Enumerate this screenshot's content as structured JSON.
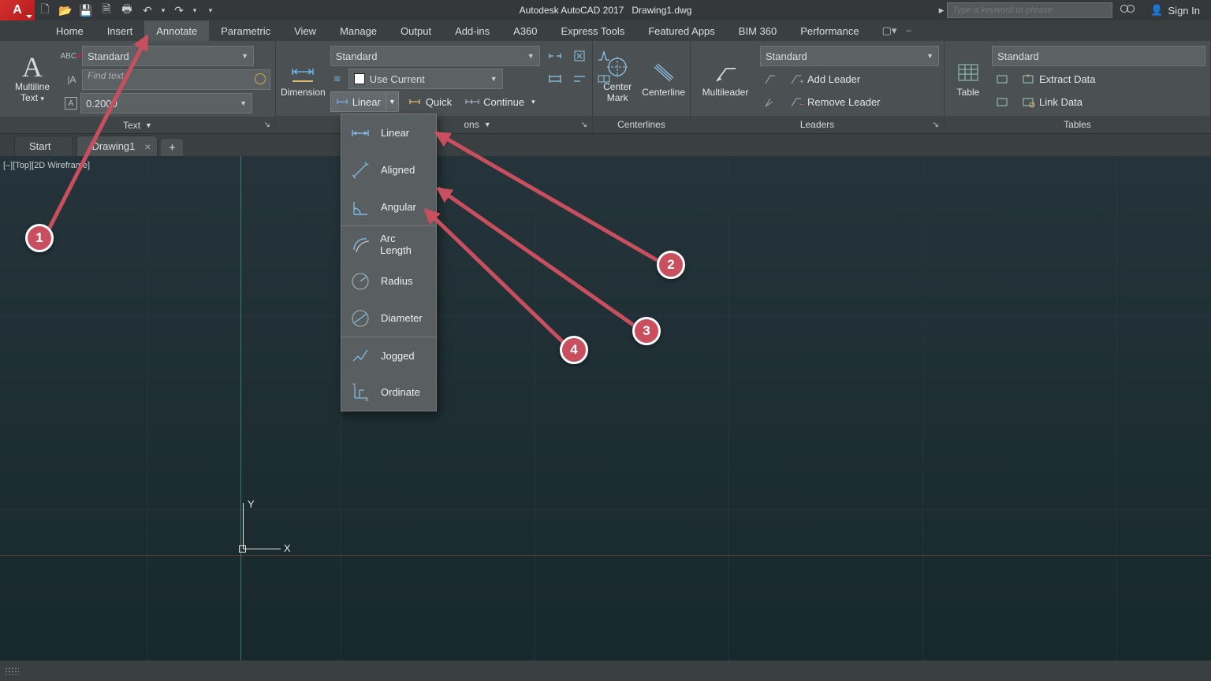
{
  "title": {
    "app": "Autodesk AutoCAD 2017",
    "doc": "Drawing1.dwg"
  },
  "search_placeholder": "Type a keyword or phrase",
  "signin": "Sign In",
  "menubar": [
    "Home",
    "Insert",
    "Annotate",
    "Parametric",
    "View",
    "Manage",
    "Output",
    "Add-ins",
    "A360",
    "Express Tools",
    "Featured Apps",
    "BIM 360",
    "Performance"
  ],
  "active_tab": "Annotate",
  "panels": {
    "text": {
      "label": "Text",
      "big": "Multiline\nText",
      "style": "Standard",
      "find_placeholder": "Find text",
      "height": "0.2000"
    },
    "dimensions": {
      "label": "Dimensions",
      "big": "Dimension",
      "style": "Standard",
      "layer": "Use Current",
      "linear": "Linear",
      "quick": "Quick",
      "continue": "Continue"
    },
    "centerlines": {
      "label": "Centerlines",
      "centermark": "Center\nMark",
      "centerline": "Centerline"
    },
    "leaders": {
      "label": "Leaders",
      "big": "Multileader",
      "style": "Standard",
      "add": "Add Leader",
      "remove": "Remove Leader"
    },
    "tables": {
      "label": "Tables",
      "big": "Table",
      "style": "Standard",
      "extract": "Extract Data",
      "link": "Link Data"
    }
  },
  "flyout": [
    "Linear",
    "Aligned",
    "Angular",
    "Arc Length",
    "Radius",
    "Diameter",
    "Jogged",
    "Ordinate"
  ],
  "tabs": {
    "start": "Start",
    "drawing": "Drawing1"
  },
  "viewlabel": "[–][Top][2D Wireframe]",
  "ucs": {
    "x": "X",
    "y": "Y"
  },
  "callouts": {
    "1": "1",
    "2": "2",
    "3": "3",
    "4": "4"
  }
}
